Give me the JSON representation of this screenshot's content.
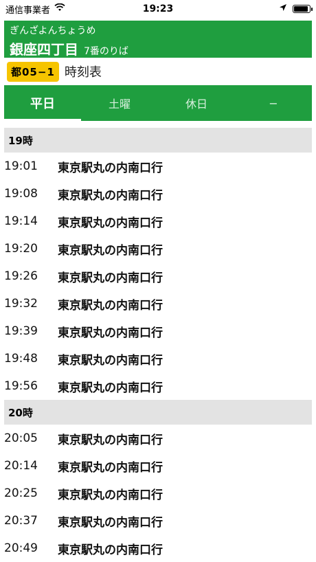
{
  "status_bar": {
    "carrier": "通信事業者",
    "time": "19:23",
    "battery_level": 0.9
  },
  "icons": {
    "wifi": "wifi-icon",
    "location": "location-arrow-icon",
    "battery": "battery-icon"
  },
  "colors": {
    "brand_green": "#1f9e3f",
    "route_badge": "#f6c400",
    "hour_header": "#e3e3e3"
  },
  "stop": {
    "kana": "ぎんざよんちょうめ",
    "name": "銀座四丁目",
    "platform": "7番のりば"
  },
  "route": {
    "badge": "都05−1",
    "title": "時刻表"
  },
  "tabs": [
    {
      "label": "平日",
      "active": true
    },
    {
      "label": "土曜",
      "active": false
    },
    {
      "label": "休日",
      "active": false
    },
    {
      "label": "−",
      "active": false
    }
  ],
  "hours": [
    {
      "label": "19時",
      "rows": [
        {
          "time": "19:01",
          "dest": "東京駅丸の内南口行"
        },
        {
          "time": "19:08",
          "dest": "東京駅丸の内南口行"
        },
        {
          "time": "19:14",
          "dest": "東京駅丸の内南口行"
        },
        {
          "time": "19:20",
          "dest": "東京駅丸の内南口行"
        },
        {
          "time": "19:26",
          "dest": "東京駅丸の内南口行"
        },
        {
          "time": "19:32",
          "dest": "東京駅丸の内南口行"
        },
        {
          "time": "19:39",
          "dest": "東京駅丸の内南口行"
        },
        {
          "time": "19:48",
          "dest": "東京駅丸の内南口行"
        },
        {
          "time": "19:56",
          "dest": "東京駅丸の内南口行"
        }
      ]
    },
    {
      "label": "20時",
      "rows": [
        {
          "time": "20:05",
          "dest": "東京駅丸の内南口行"
        },
        {
          "time": "20:14",
          "dest": "東京駅丸の内南口行"
        },
        {
          "time": "20:25",
          "dest": "東京駅丸の内南口行"
        },
        {
          "time": "20:37",
          "dest": "東京駅丸の内南口行"
        },
        {
          "time": "20:49",
          "dest": "東京駅丸の内南口行"
        }
      ]
    }
  ]
}
